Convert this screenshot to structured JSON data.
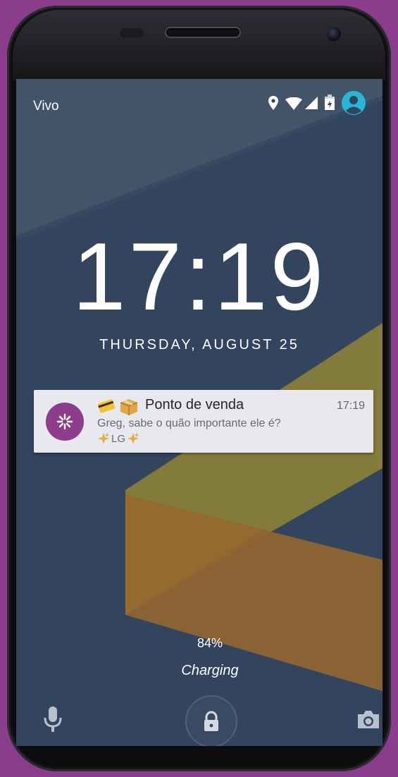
{
  "status_bar": {
    "carrier": "Vivo",
    "icons": [
      "location-icon",
      "wifi-icon",
      "signal-icon",
      "battery-charging-icon",
      "user-avatar-icon"
    ]
  },
  "lockscreen": {
    "time": "17:19",
    "date": "THURSDAY, AUGUST 25"
  },
  "notification": {
    "app_icon": "sparkle-asterisk-icon",
    "title_emojis": [
      "credit-card-emoji",
      "package-emoji"
    ],
    "title": "Ponto de venda",
    "time": "17:19",
    "body": "Greg, sabe o quão importante ele é?",
    "signature": "LG"
  },
  "charging": {
    "battery_percent": "84%",
    "label": "Charging"
  },
  "bottom_actions": {
    "left": "microphone-icon",
    "center": "lock-icon",
    "right": "camera-icon"
  },
  "colors": {
    "wallpaper_base": "#33455e",
    "wallpaper_light": "#425468",
    "yellow_band": "#8a8038",
    "orange_band": "#8e6530",
    "notif_avatar": "#8d3d8b",
    "status_accent": "#29b6d6"
  }
}
